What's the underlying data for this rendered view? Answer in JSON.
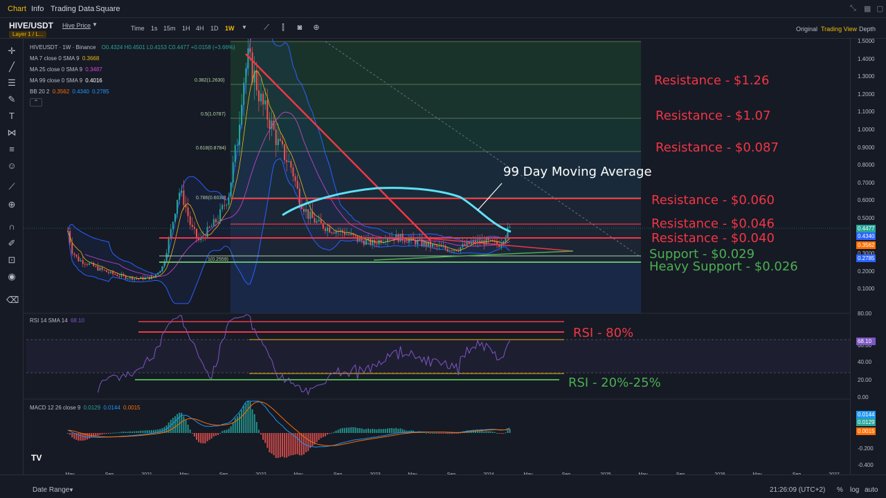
{
  "topnav": {
    "tabs": [
      "Chart",
      "Info",
      "Trading Data",
      "Square"
    ],
    "active_tab": "Chart"
  },
  "toolbar": {
    "pair": "HIVE/USDT",
    "pair_sub": "Hive Price",
    "layer_badge": "Layer 1 / L...",
    "timeframes": [
      "Time",
      "1s",
      "15m",
      "1H",
      "4H",
      "1D",
      "1W"
    ],
    "active_timeframe": "1W",
    "views": [
      "Original",
      "Trading View",
      "Depth"
    ],
    "active_view": "Trading View"
  },
  "legend": {
    "title": "HIVEUSDT · 1W · Binance",
    "ohlc": "O0.4324 H0.4501 L0.4153 C0.4477 +0.0158 (+3.66%)",
    "ma7_label": "MA 7 close 0 SMA 9",
    "ma7_value": "0.3668",
    "ma25_label": "MA 25 close 0 SMA 9",
    "ma25_value": "0.3487",
    "ma99_label": "MA 99 close 0 SMA 9",
    "ma99_value": "0.4016",
    "bb_label": "BB 20 2",
    "bb_values": [
      "0.3562",
      "0.4340",
      "0.2785"
    ],
    "rsi_label": "RSI 14 SMA 14",
    "rsi_value": "68.10",
    "macd_label": "MACD 12 26 close 9",
    "macd_values": [
      "0.0129",
      "0.0144",
      "0.0015"
    ]
  },
  "fib_labels": [
    "0.382(1.2630)",
    "0.5(1.0787)",
    "0.618(0.8784)",
    "0.786(0.6036)",
    "1(0.2559)"
  ],
  "annotations": {
    "res_126": "Resistance - $1.26",
    "res_107": "Resistance - $1.07",
    "res_0087": "Resistance - $0.087",
    "res_0060": "Resistance - $0.060",
    "res_0046": "Resistance - $0.046",
    "res_0040": "Resistance - $0.040",
    "sup_0029": "Support - $0.029",
    "heavy_sup": "Heavy Support - $0.026",
    "ma99_text": "99 Day Moving Average",
    "rsi80": "RSI - 80%",
    "rsi20": "RSI - 20%-25%"
  },
  "price_axis": {
    "ticks": [
      "1.5000",
      "1.4000",
      "1.3000",
      "1.2000",
      "1.1000",
      "1.0000",
      "0.9000",
      "0.8000",
      "0.7000",
      "0.6000",
      "0.5000",
      "0.4000",
      "0.3000",
      "0.2000",
      "0.1000"
    ],
    "badges": [
      {
        "value": "0.4477",
        "color": "#26a69a"
      },
      {
        "value": "0.4340",
        "color": "#2962ff"
      },
      {
        "value": "0.3562",
        "color": "#ff6d00"
      },
      {
        "value": "0.2785",
        "color": "#2962ff"
      }
    ]
  },
  "rsi_axis": {
    "ticks": [
      "80.00",
      "60.00",
      "40.00",
      "20.00",
      "0.00"
    ],
    "badge": "68.10"
  },
  "macd_axis": {
    "ticks": [
      "-0.200",
      "-0.400"
    ],
    "badges": [
      {
        "value": "0.0144",
        "color": "#2196f3"
      },
      {
        "value": "0.0129",
        "color": "#26a69a"
      },
      {
        "value": "0.0015",
        "color": "#ff6d00"
      }
    ]
  },
  "time_axis": [
    "May",
    "Sep",
    "2021",
    "May",
    "Sep",
    "2022",
    "May",
    "Sep",
    "2023",
    "May",
    "Sep",
    "2024",
    "May",
    "Sep",
    "2025",
    "May",
    "Sep",
    "2026",
    "May",
    "Sep",
    "2027"
  ],
  "bottombar": {
    "date_range": "Date Range",
    "clock": "21:26:09 (UTC+2)",
    "pct": "%",
    "log": "log",
    "auto": "auto"
  },
  "colors": {
    "bull": "#26a69a",
    "bear": "#ef5350",
    "resistance": "#f23645",
    "support": "#4caf50",
    "ma99": "#5ee1f5",
    "accent": "#f0b90b"
  },
  "chart_data": {
    "type": "candlestick",
    "series": [
      {
        "name": "HIVEUSDT 1W",
        "values": [
          0.45,
          0.3,
          0.26,
          0.22,
          0.2,
          0.24,
          0.36,
          0.5,
          0.4,
          0.32,
          0.45,
          0.62,
          1.3,
          1.1,
          0.95,
          0.7,
          0.55,
          0.42,
          0.38,
          0.36,
          0.37,
          0.34,
          0.32,
          0.33,
          0.3,
          0.36,
          0.44
        ]
      }
    ],
    "x_range": [
      "2020-04",
      "2027-06"
    ],
    "ylim": [
      0.05,
      1.52
    ]
  }
}
